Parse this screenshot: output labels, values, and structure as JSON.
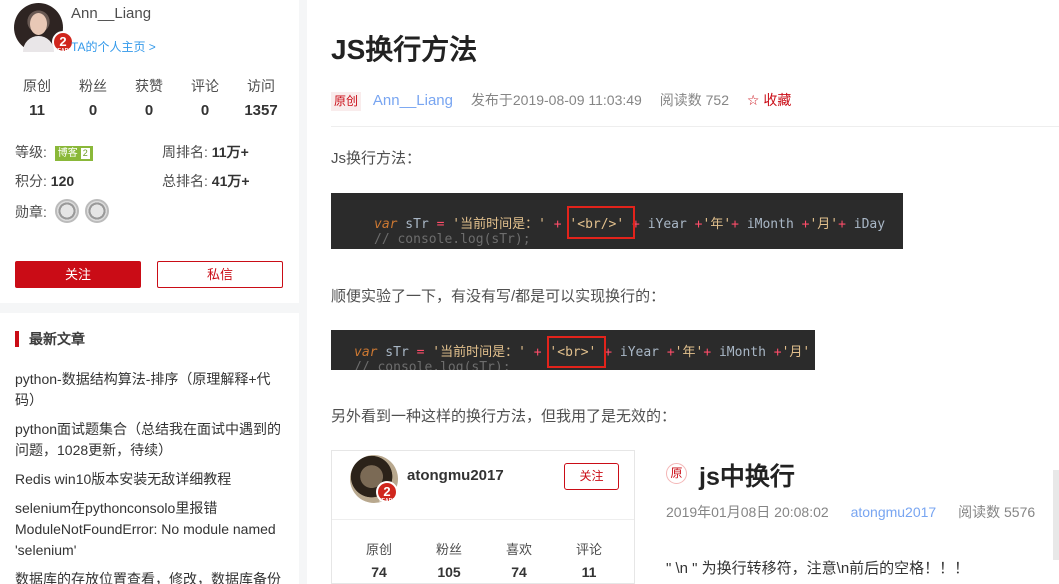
{
  "sidebar": {
    "username": "Ann__Liang",
    "homepage_link": "TA的个人主页 >",
    "avatar_badge": "2",
    "stats": [
      {
        "label": "原创",
        "value": "11"
      },
      {
        "label": "粉丝",
        "value": "0"
      },
      {
        "label": "获赞",
        "value": "0"
      },
      {
        "label": "评论",
        "value": "0"
      },
      {
        "label": "访问",
        "value": "1357"
      }
    ],
    "level_label": "等级:",
    "level_tag": "博客",
    "level_num": "2",
    "week_rank_label": "周排名:",
    "week_rank_value": "11万+",
    "points_label": "积分:",
    "points_value": "120",
    "total_rank_label": "总排名:",
    "total_rank_value": "41万+",
    "medals_label": "勋章:",
    "follow_button": "关注",
    "message_button": "私信",
    "recent_title": "最新文章",
    "recent_articles": [
      "python-数据结构算法-排序（原理解释+代码）",
      "python面试题集合（总结我在面试中遇到的问题，1028更新，待续）",
      "Redis win10版本安装无敌详细教程",
      "selenium在pythonconsolo里报错ModuleNotFoundError: No module named 'selenium'",
      "数据库的存放位置查看，修改，数据库备份"
    ]
  },
  "article": {
    "title": "JS换行方法",
    "original_tag": "原创",
    "author": "Ann__Liang",
    "published": "发布于2019-08-09 11:03:49",
    "reads": "阅读数 752",
    "collect": "☆ 收藏",
    "p1": "Js换行方法：",
    "p2": "顺便实验了一下，有没有写/都是可以实现换行的：",
    "p3": "另外看到一种这样的换行方法，但我用了是无效的：",
    "code1": {
      "kw": "var",
      "line1": [
        " sTr ",
        "= ",
        "'当前时间是：'",
        " + ",
        "'<br/>'",
        " + ",
        "iYear ",
        "+",
        "'年'",
        "+ ",
        "iMonth ",
        "+",
        "'月'",
        "+ ",
        "iDay"
      ],
      "line2": "// console.log(sTr);"
    },
    "code2": {
      "kw": "var",
      "line1": [
        " sTr ",
        "= ",
        "'当前时间是：'",
        " + ",
        "'<br>'",
        " + ",
        "iYear ",
        "+",
        "'年'",
        "+ ",
        "iMonth ",
        "+",
        "'月'"
      ],
      "line2": "// console.log(sTr);"
    }
  },
  "embedded": {
    "username": "atongmu2017",
    "avatar_badge": "2",
    "follow_button": "关注",
    "stats": [
      {
        "label": "原创",
        "value": "74"
      },
      {
        "label": "粉丝",
        "value": "105"
      },
      {
        "label": "喜欢",
        "value": "74"
      },
      {
        "label": "评论",
        "value": "11"
      }
    ],
    "orig_tag": "原",
    "title": "js中换行",
    "date": "2019年01月08日 20:08:02",
    "author": "atongmu2017",
    "reads": "阅读数 5576",
    "text": "\" \\n \" 为换行转移符，注意\\n前后的空格！！！"
  }
}
